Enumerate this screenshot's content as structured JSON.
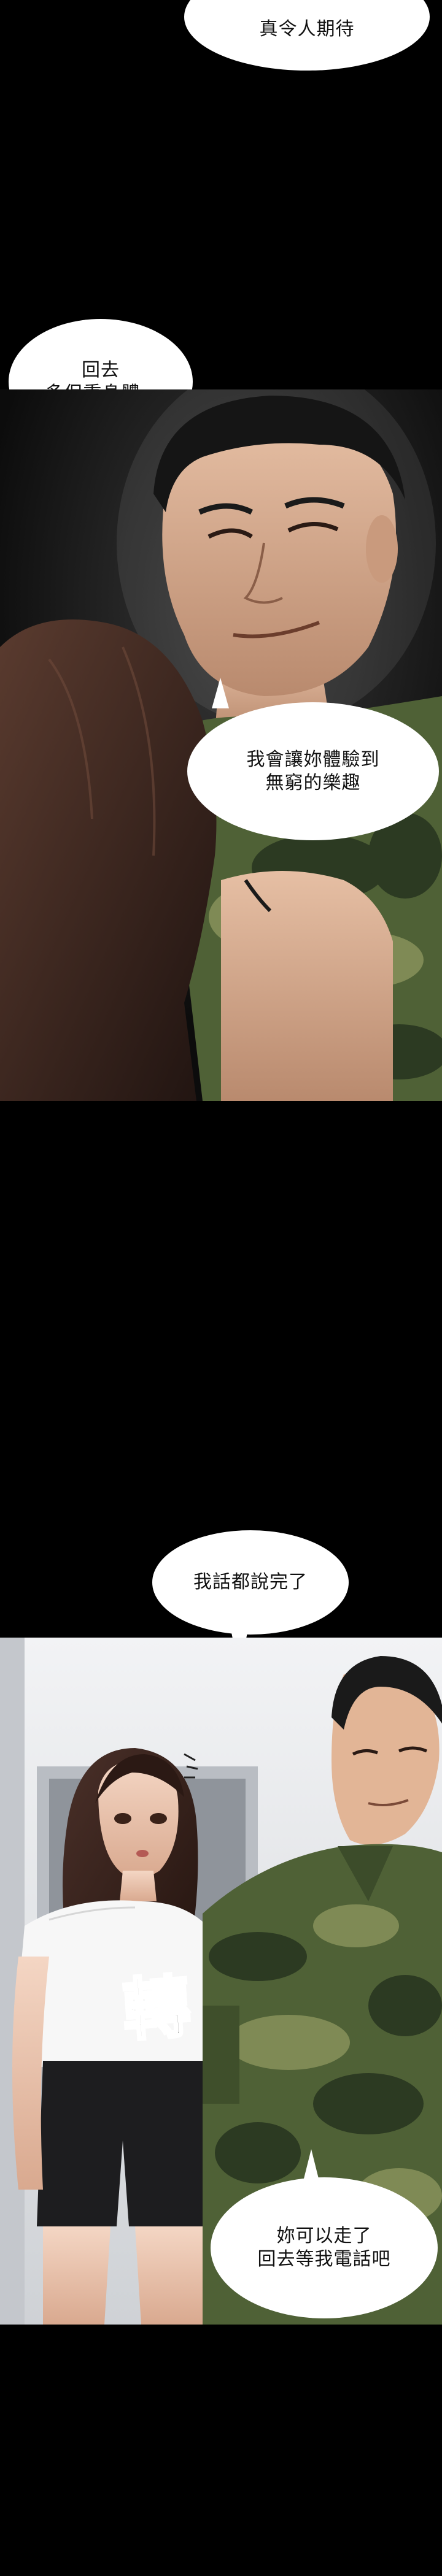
{
  "bubbles": {
    "b1": {
      "lines": [
        "真令人期待"
      ]
    },
    "b2": {
      "lines": [
        "回去",
        "多保重身體~"
      ]
    },
    "b3": {
      "lines": [
        "我會讓妳體驗到",
        "無窮的樂趣"
      ]
    },
    "b4": {
      "lines": [
        "我話都說完了"
      ]
    },
    "b5": {
      "lines": [
        "妳可以走了",
        "回去等我電話吧"
      ]
    }
  },
  "sfx": {
    "text": "轉"
  },
  "colors": {
    "page_bg": "#000000",
    "bubble_bg": "#ffffff",
    "camo_dark": "#2c3a22",
    "camo_mid": "#4f6136",
    "camo_light": "#7f8a55",
    "hair": "#3a2620",
    "skin": "#e9c3ad"
  }
}
